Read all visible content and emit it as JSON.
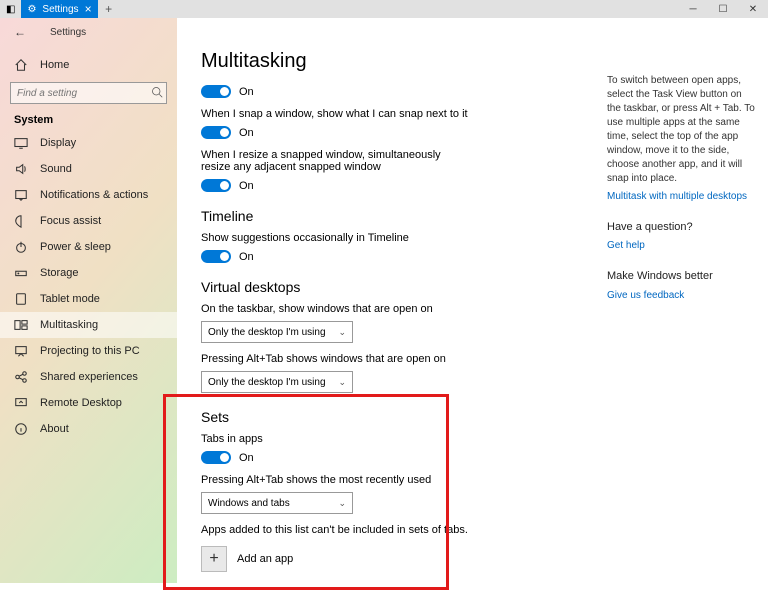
{
  "titlebar": {
    "tab": "Settings",
    "min": "─",
    "max": "☐",
    "close": "✕"
  },
  "sidebar": {
    "back": "←",
    "header_label": "Settings",
    "search_placeholder": "Find a setting",
    "group": "System",
    "items": [
      {
        "icon": "home-icon",
        "label": "Home"
      },
      {
        "icon": "display-icon",
        "label": "Display"
      },
      {
        "icon": "sound-icon",
        "label": "Sound"
      },
      {
        "icon": "notifications-icon",
        "label": "Notifications & actions"
      },
      {
        "icon": "focus-icon",
        "label": "Focus assist"
      },
      {
        "icon": "power-icon",
        "label": "Power & sleep"
      },
      {
        "icon": "storage-icon",
        "label": "Storage"
      },
      {
        "icon": "tablet-icon",
        "label": "Tablet mode"
      },
      {
        "icon": "multitask-icon",
        "label": "Multitasking"
      },
      {
        "icon": "project-icon",
        "label": "Projecting to this PC"
      },
      {
        "icon": "shared-icon",
        "label": "Shared experiences"
      },
      {
        "icon": "remote-icon",
        "label": "Remote Desktop"
      },
      {
        "icon": "about-icon",
        "label": "About"
      }
    ]
  },
  "page": {
    "title": "Multitasking",
    "snap1": {
      "state": "On"
    },
    "snap2": {
      "label": "When I snap a window, show what I can snap next to it",
      "state": "On"
    },
    "snap3": {
      "label": "When I resize a snapped window, simultaneously resize any adjacent snapped window",
      "state": "On"
    },
    "timeline": {
      "title": "Timeline",
      "label": "Show suggestions occasionally in Timeline",
      "state": "On"
    },
    "vd": {
      "title": "Virtual desktops",
      "taskbar_label": "On the taskbar, show windows that are open on",
      "taskbar_value": "Only the desktop I'm using",
      "alttab_label": "Pressing Alt+Tab shows windows that are open on",
      "alttab_value": "Only the desktop I'm using"
    },
    "sets": {
      "title": "Sets",
      "tabs_label": "Tabs in apps",
      "tabs_state": "On",
      "alttab_label": "Pressing Alt+Tab shows the most recently used",
      "alttab_value": "Windows and tabs",
      "note": "Apps added to this list can't be included in sets of tabs.",
      "add": "Add an app"
    }
  },
  "right": {
    "help1": "To switch between open apps, select the Task View button on the taskbar, or press Alt + Tab. To use multiple apps at the same time, select the top of the app window, move it to the side, choose another app, and it will snap into place.",
    "link1": "Multitask with multiple desktops",
    "q": "Have a question?",
    "link2": "Get help",
    "fb": "Make Windows better",
    "link3": "Give us feedback"
  }
}
